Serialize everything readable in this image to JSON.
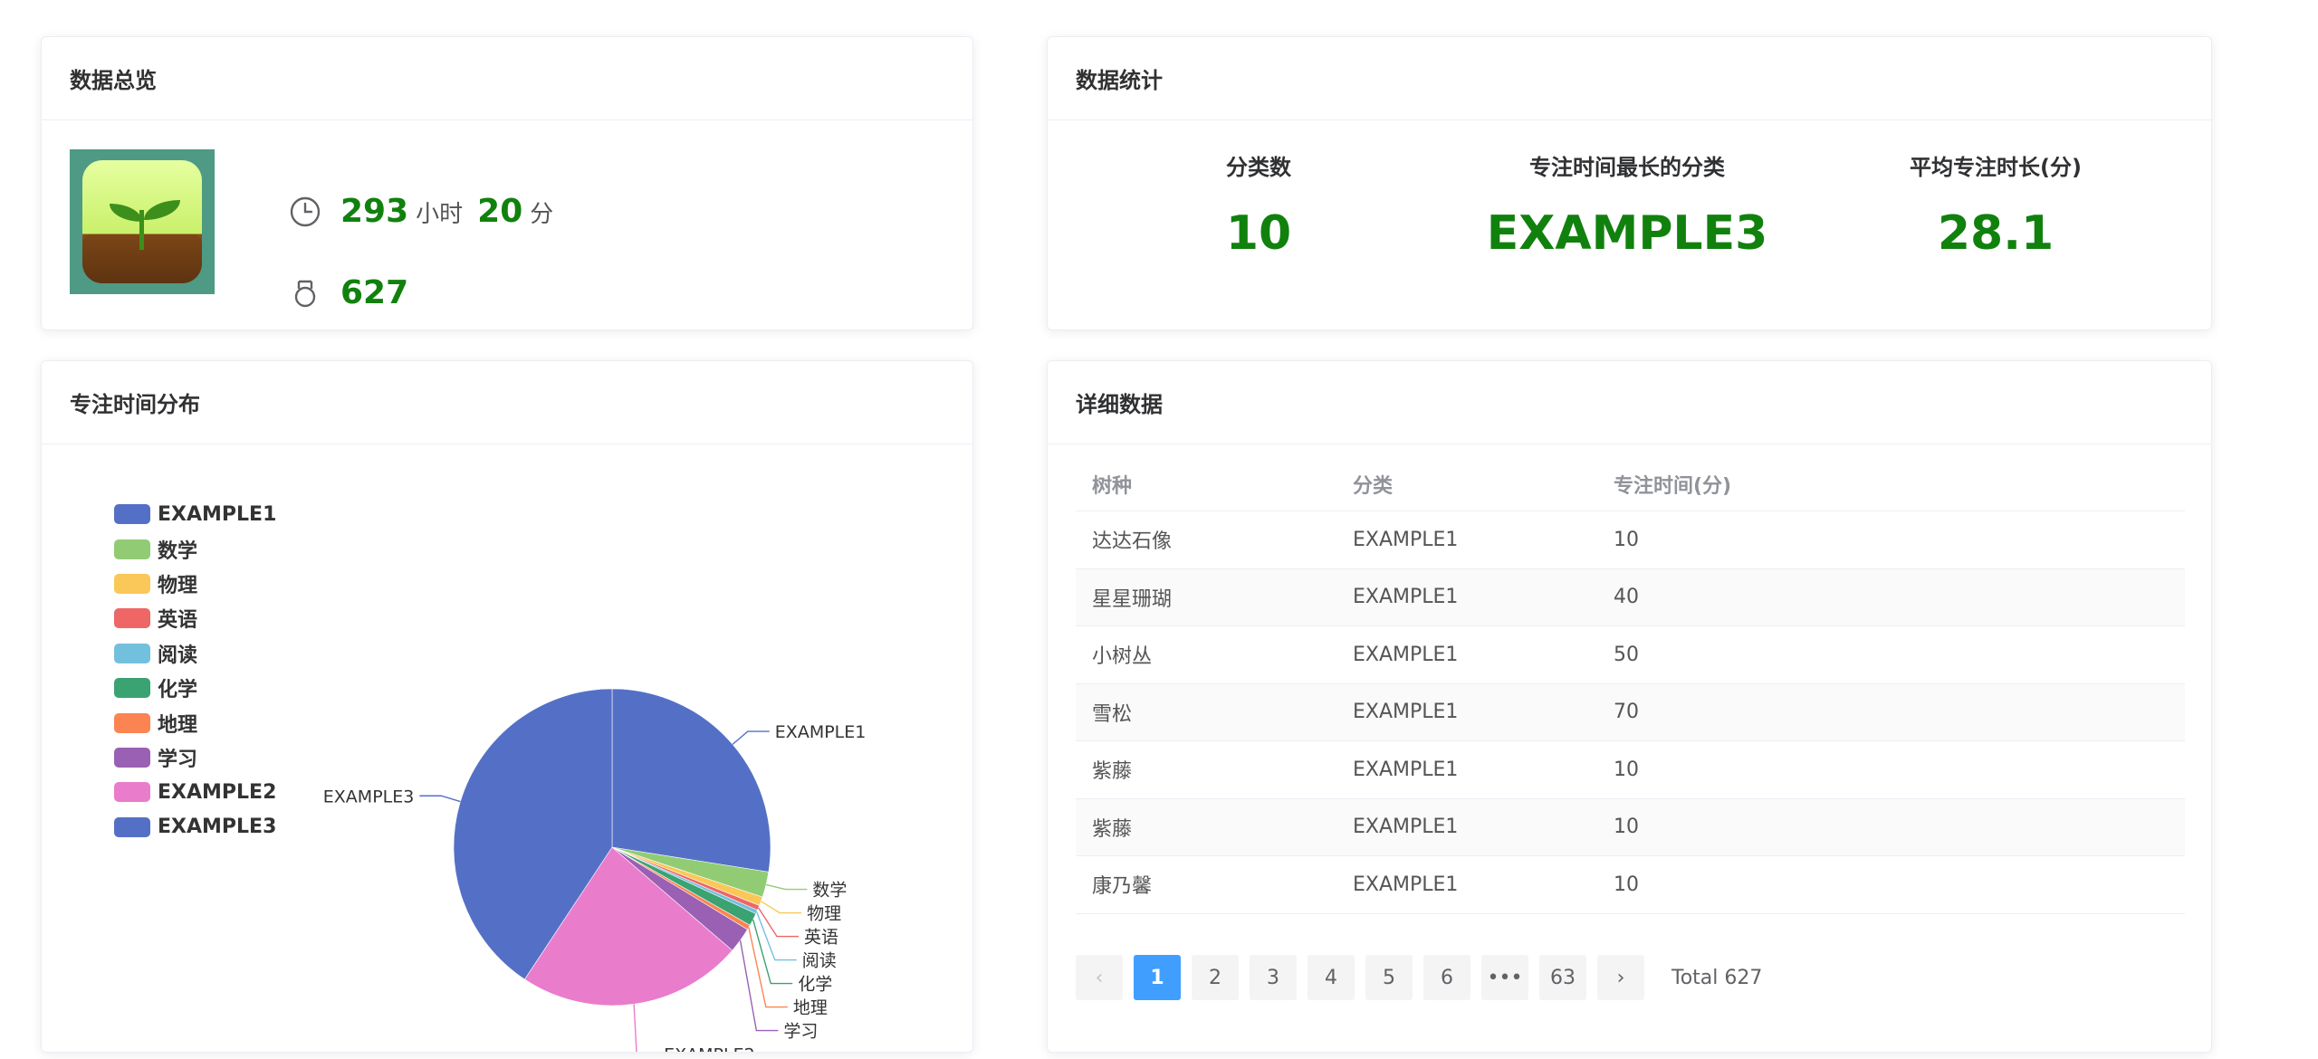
{
  "overview": {
    "title": "数据总览",
    "hours": "293",
    "hours_unit": "小时",
    "minutes": "20",
    "minutes_unit": "分",
    "count": "627"
  },
  "stats": {
    "title": "数据统计",
    "items": [
      {
        "label": "分类数",
        "value": "10"
      },
      {
        "label": "专注时间最长的分类",
        "value": "EXAMPLE3"
      },
      {
        "label": "平均专注时长(分)",
        "value": "28.1"
      }
    ]
  },
  "distribution": {
    "title": "专注时间分布"
  },
  "chart_data": {
    "type": "pie",
    "categories": [
      "EXAMPLE1",
      "数学",
      "物理",
      "英语",
      "阅读",
      "化学",
      "地理",
      "学习",
      "EXAMPLE2",
      "EXAMPLE3"
    ],
    "values": [
      27.5,
      2.6,
      0.9,
      0.5,
      0.4,
      1.3,
      0.5,
      2.6,
      23.0,
      40.7
    ],
    "colors": [
      "#5470c6",
      "#91cc75",
      "#fac858",
      "#ee6666",
      "#73c0de",
      "#3ba272",
      "#fc8452",
      "#9a60b4",
      "#ea7ccc",
      "#5470c6"
    ],
    "legend_position": "top-left"
  },
  "detail": {
    "title": "详细数据",
    "columns": [
      "树种",
      "分类",
      "专注时间(分)"
    ],
    "rows": [
      [
        "达达石像",
        "EXAMPLE1",
        "10"
      ],
      [
        "星星珊瑚",
        "EXAMPLE1",
        "40"
      ],
      [
        "小树丛",
        "EXAMPLE1",
        "50"
      ],
      [
        "雪松",
        "EXAMPLE1",
        "70"
      ],
      [
        "紫藤",
        "EXAMPLE1",
        "10"
      ],
      [
        "紫藤",
        "EXAMPLE1",
        "10"
      ],
      [
        "康乃馨",
        "EXAMPLE1",
        "10"
      ]
    ],
    "pagination": {
      "prev": "‹",
      "next": "›",
      "pages": [
        "1",
        "2",
        "3",
        "4",
        "5",
        "6",
        "•••",
        "63"
      ],
      "current": "1",
      "total_text": "Total 627"
    }
  }
}
